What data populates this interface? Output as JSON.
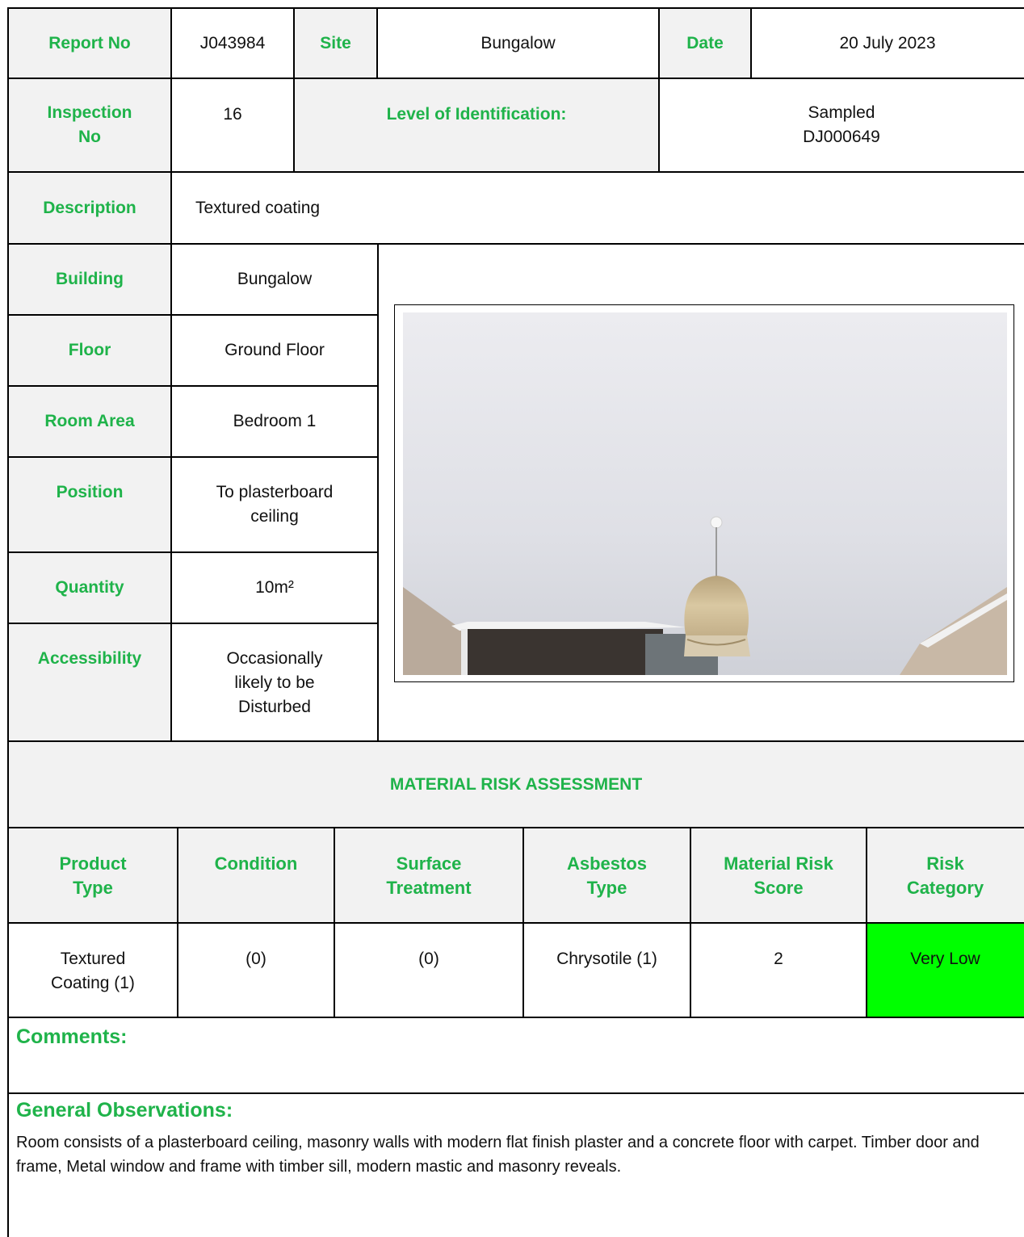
{
  "header": {
    "report_no_label": "Report No",
    "report_no": "J043984",
    "site_label": "Site",
    "site": "Bungalow",
    "date_label": "Date",
    "date": "20 July 2023",
    "inspection_no_label": [
      "Inspection",
      "No"
    ],
    "inspection_no": "16",
    "level_label": "Level of Identification:",
    "level_value": [
      "Sampled",
      "DJ000649"
    ]
  },
  "description": {
    "label": "Description",
    "value": "Textured coating"
  },
  "details": [
    {
      "label": [
        "Building"
      ],
      "value": [
        "Bungalow"
      ]
    },
    {
      "label": [
        "Floor"
      ],
      "value": [
        "Ground Floor"
      ]
    },
    {
      "label": [
        "Room Area"
      ],
      "value": [
        "Bedroom 1"
      ]
    },
    {
      "label": [
        "Position"
      ],
      "value": [
        "To plasterboard",
        "ceiling"
      ]
    },
    {
      "label": [
        "Quantity"
      ],
      "value": [
        "10m²"
      ]
    },
    {
      "label": [
        "Accessibility"
      ],
      "value": [
        "Occasionally",
        "likely to be",
        "Disturbed"
      ]
    }
  ],
  "photo": {
    "subject": "plasterboard ceiling with pendant lampshade",
    "colors": {
      "ceiling": "#e3e4e8",
      "lampshade": "#c8b592"
    }
  },
  "mra": {
    "title": "MATERIAL RISK ASSESSMENT",
    "headers": [
      [
        "Product",
        "Type"
      ],
      [
        "Condition"
      ],
      [
        "Surface",
        "Treatment"
      ],
      [
        "Asbestos",
        "Type"
      ],
      [
        "Material Risk",
        "Score"
      ],
      [
        "Risk",
        "Category"
      ]
    ],
    "values": [
      [
        "Textured",
        "Coating (1)"
      ],
      [
        "(0)"
      ],
      [
        "(0)"
      ],
      [
        "Chrysotile (1)"
      ],
      [
        "2"
      ],
      [
        "Very Low"
      ]
    ],
    "risk_color": "#00ff00"
  },
  "comments": {
    "label": "Comments:",
    "text": ""
  },
  "observations": {
    "label": "General Observations:",
    "text": "Room consists of a plasterboard ceiling, masonry walls with modern flat finish plaster and a concrete floor with carpet. Timber door and frame, Metal window and frame with timber sill, modern mastic and masonry reveals."
  },
  "colors": {
    "label_green": "#1fb34a",
    "label_bg": "#f2f2f2"
  }
}
